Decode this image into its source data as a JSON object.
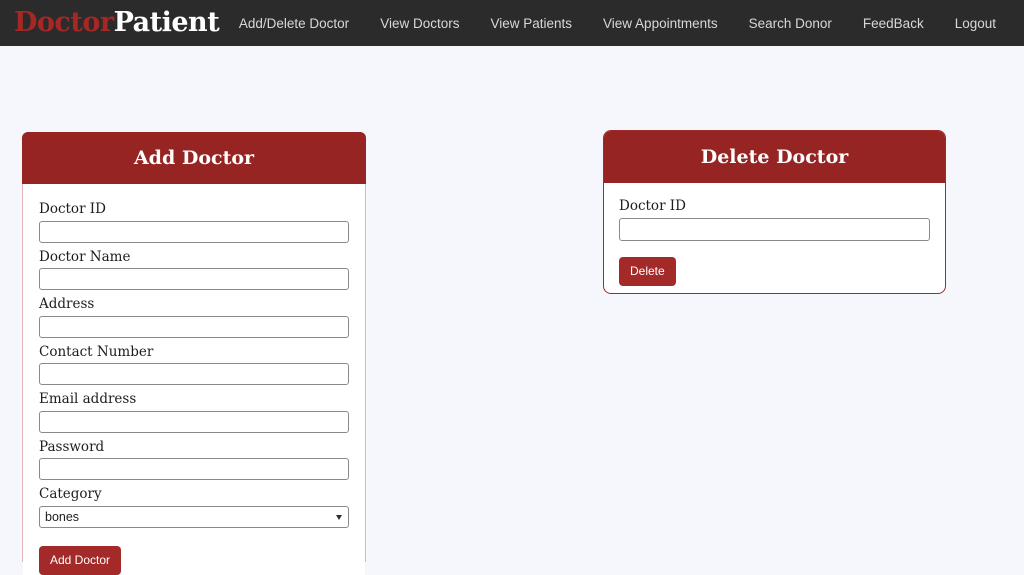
{
  "navbar": {
    "brand": {
      "part1": "Doctor",
      "part2": "Patient",
      "color_part1": "#a52824",
      "color_part2": "#ffffff"
    },
    "background": "#2b2b2b",
    "links": [
      {
        "label": "Add/Delete Doctor"
      },
      {
        "label": "View Doctors"
      },
      {
        "label": "View Patients"
      },
      {
        "label": "View Appointments"
      },
      {
        "label": "Search Donor"
      },
      {
        "label": "FeedBack"
      },
      {
        "label": "Logout"
      }
    ]
  },
  "theme": {
    "page_background": "#f6f7fc",
    "header_red": "#962422",
    "button_red": "#a32a28",
    "card_border_red": "#9e2b28",
    "card_border_pink": "#e3b6b5"
  },
  "add_doctor_card": {
    "title": "Add Doctor",
    "fields": [
      {
        "label": "Doctor ID",
        "value": "",
        "placeholder": "",
        "type": "text"
      },
      {
        "label": "Doctor Name",
        "value": "",
        "placeholder": "",
        "type": "text"
      },
      {
        "label": "Address",
        "value": "",
        "placeholder": "",
        "type": "text"
      },
      {
        "label": "Contact Number",
        "value": "",
        "placeholder": "",
        "type": "text"
      },
      {
        "label": "Email address",
        "value": "",
        "placeholder": "",
        "type": "text"
      },
      {
        "label": "Password",
        "value": "",
        "placeholder": "",
        "type": "password"
      }
    ],
    "category": {
      "label": "Category",
      "selected": "bones"
    },
    "submit_label": "Add Doctor"
  },
  "delete_doctor_card": {
    "title": "Delete Doctor",
    "fields": [
      {
        "label": "Doctor ID",
        "value": "",
        "placeholder": "",
        "type": "text"
      }
    ],
    "submit_label": "Delete"
  }
}
